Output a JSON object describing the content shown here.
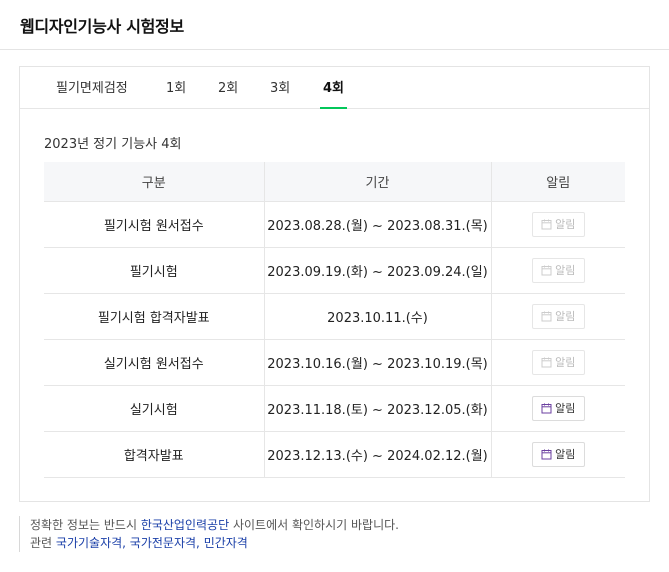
{
  "header": {
    "title": "웹디자인기능사 시험정보"
  },
  "tabs": [
    {
      "label": "필기면제검정",
      "active": false
    },
    {
      "label": "1회",
      "active": false
    },
    {
      "label": "2회",
      "active": false
    },
    {
      "label": "3회",
      "active": false
    },
    {
      "label": "4회",
      "active": true
    }
  ],
  "schedule": {
    "subtitle": "2023년 정기 기능사 4회",
    "columns": [
      "구분",
      "기간",
      "알림"
    ],
    "rows": [
      {
        "category": "필기시험 원서접수",
        "period": "2023.08.28.(월) ~ 2023.08.31.(목)",
        "alarm_label": "알림",
        "alarm_enabled": false
      },
      {
        "category": "필기시험",
        "period": "2023.09.19.(화) ~ 2023.09.24.(일)",
        "alarm_label": "알림",
        "alarm_enabled": false
      },
      {
        "category": "필기시험 합격자발표",
        "period": "2023.10.11.(수)",
        "alarm_label": "알림",
        "alarm_enabled": false
      },
      {
        "category": "실기시험 원서접수",
        "period": "2023.10.16.(월) ~ 2023.10.19.(목)",
        "alarm_label": "알림",
        "alarm_enabled": false
      },
      {
        "category": "실기시험",
        "period": "2023.11.18.(토) ~ 2023.12.05.(화)",
        "alarm_label": "알림",
        "alarm_enabled": true
      },
      {
        "category": "합격자발표",
        "period": "2023.12.13.(수) ~ 2024.02.12.(월)",
        "alarm_label": "알림",
        "alarm_enabled": true
      }
    ]
  },
  "footer": {
    "notice_prefix": "정확한 정보는 반드시 ",
    "notice_link": "한국산업인력공단",
    "notice_suffix": " 사이트에서 확인하시기 바랍니다.",
    "related_label": "관련 ",
    "related_links": [
      "국가기술자격",
      "국가전문자격",
      "민간자격"
    ]
  },
  "colors": {
    "active_tab_underline": "#03c75a",
    "link": "#1a3fa8",
    "calendar_icon_enabled": "#6b3fa0",
    "calendar_icon_disabled": "#cccccc"
  }
}
